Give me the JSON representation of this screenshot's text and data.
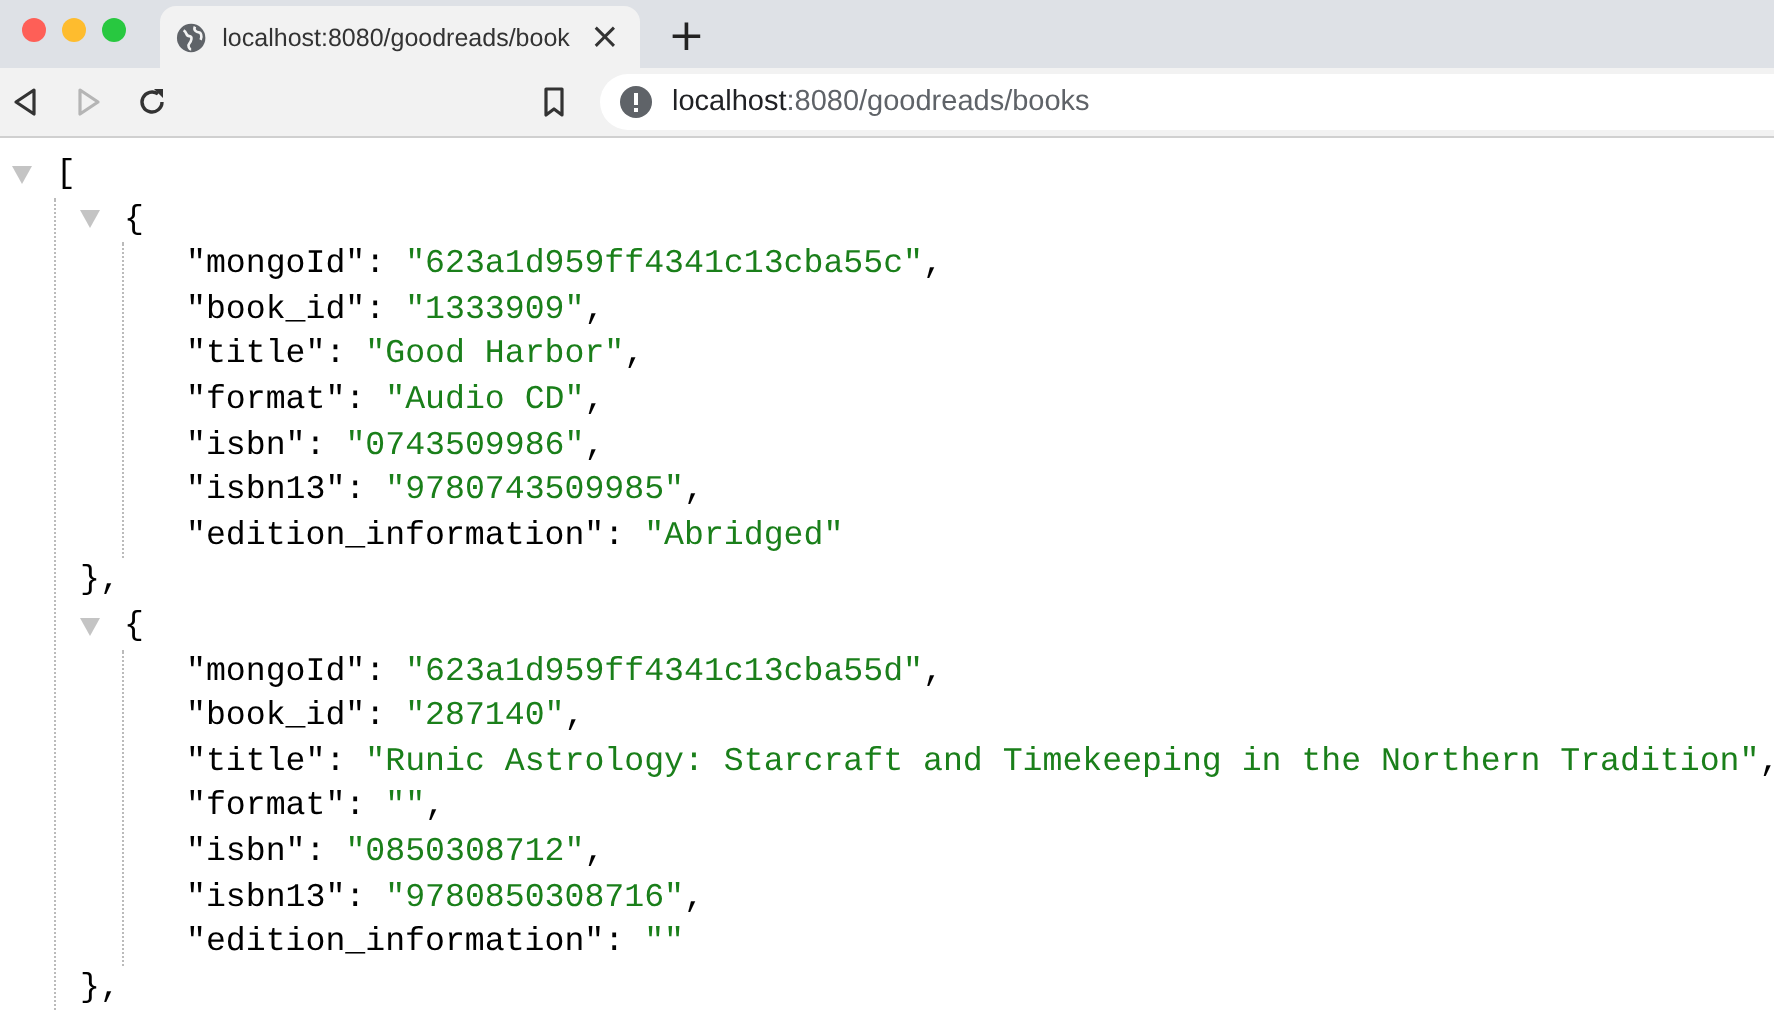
{
  "browser": {
    "tab": {
      "title": "localhost:8080/goodreads/book",
      "close": "×",
      "selected": true
    },
    "new_tab": "+",
    "address": {
      "host": "localhost",
      "rest": ":8080/goodreads/books"
    },
    "forward_disabled": true
  },
  "viewer": {
    "root": {
      "open": "[",
      "expanded": true
    },
    "objects": [
      {
        "open": "{",
        "close": "},",
        "expanded": true,
        "entries": [
          {
            "key": "\"mongoId\":",
            "value": "\"623a1d959ff4341c13cba55c\"",
            "comma": ","
          },
          {
            "key": "\"book_id\":",
            "value": "\"1333909\"",
            "comma": ","
          },
          {
            "key": "\"title\":",
            "value": "\"Good Harbor\"",
            "comma": ","
          },
          {
            "key": "\"format\":",
            "value": "\"Audio CD\"",
            "comma": ","
          },
          {
            "key": "\"isbn\":",
            "value": "\"0743509986\"",
            "comma": ","
          },
          {
            "key": "\"isbn13\":",
            "value": "\"9780743509985\"",
            "comma": ","
          },
          {
            "key": "\"edition_information\":",
            "value": "\"Abridged\""
          }
        ]
      },
      {
        "open": "{",
        "close": "},",
        "expanded": true,
        "entries": [
          {
            "key": "\"mongoId\":",
            "value": "\"623a1d959ff4341c13cba55d\"",
            "comma": ","
          },
          {
            "key": "\"book_id\":",
            "value": "\"287140\"",
            "comma": ","
          },
          {
            "key": "\"title\":",
            "value": "\"Runic Astrology: Starcraft and Timekeeping in the Northern Tradition\"",
            "comma": ","
          },
          {
            "key": "\"format\":",
            "value": "\"\"",
            "comma": ","
          },
          {
            "key": "\"isbn\":",
            "value": "\"0850308712\"",
            "comma": ","
          },
          {
            "key": "\"isbn13\":",
            "value": "\"9780850308716\"",
            "comma": ","
          },
          {
            "key": "\"edition_information\":",
            "value": "\"\""
          }
        ]
      }
    ]
  }
}
